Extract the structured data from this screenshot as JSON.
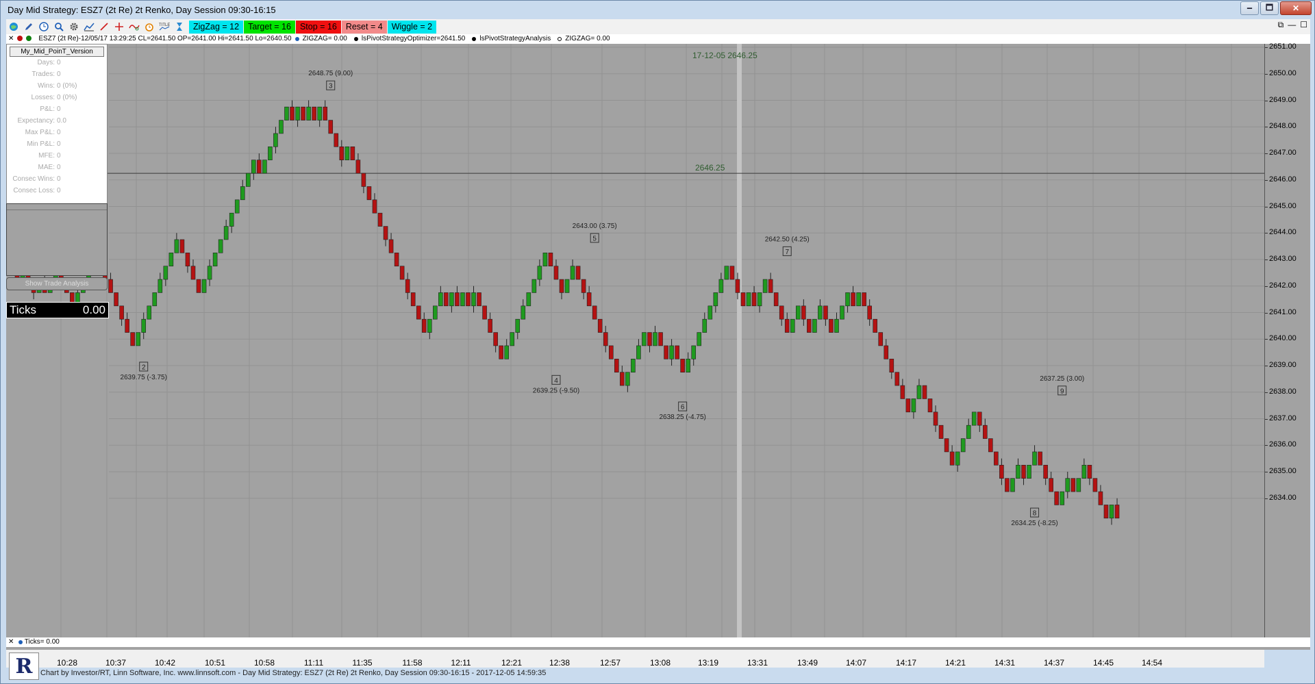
{
  "window": {
    "title": "Day Mid Strategy: ESZ7 (2t Re) 2t Renko, Day Session 09:30-16:15",
    "ctrl_restore": "🗗",
    "ctrl_min": "🗕",
    "ctrl_max": "🗖",
    "ctrl_close": "✕"
  },
  "toolbar": {
    "tools": [
      "globe-icon",
      "pencil-icon",
      "clock-icon",
      "magnifier-icon",
      "gear-icon",
      "chart-icon",
      "line-icon",
      "crosshair-icon",
      "link-icon",
      "alarm-icon",
      "title-icon",
      "hourglass-icon"
    ],
    "params": [
      {
        "label": "ZigZag = 12",
        "color": "#00e5ee"
      },
      {
        "label": "Target = 16",
        "color": "#00e400"
      },
      {
        "label": "Stop = 16",
        "color": "#f01010"
      },
      {
        "label": "Reset = 4",
        "color": "#f28a8a"
      },
      {
        "label": "Wiggle = 2",
        "color": "#00e5ee"
      }
    ],
    "right_icons": [
      "⧉",
      "—",
      "☐"
    ]
  },
  "infobar": {
    "close": "✕",
    "main": "ESZ7 (2t Re)-12/05/17 13:29:25 CL=2641.50 OP=2641.00 Hi=2641.50 Lo=2640.50",
    "zigzag": "ZIGZAG= 0.00",
    "optimizer": "lsPivotStrategyOptimizer=2641.50",
    "analysis": "lsPivotStrategyAnalysis",
    "zigzag2": "ZIGZAG= 0.00"
  },
  "stats": {
    "title": "My_Mid_PoinT_Version",
    "rows": [
      {
        "label": "Days:",
        "value": "0"
      },
      {
        "label": "Trades:",
        "value": "0"
      },
      {
        "label": "Wins:",
        "value": "0 (0%)"
      },
      {
        "label": "Losses:",
        "value": "0 (0%)"
      },
      {
        "label": "P&L:",
        "value": "0"
      },
      {
        "label": "Expectancy:",
        "value": "0.0"
      },
      {
        "label": "Max P&L:",
        "value": "0"
      },
      {
        "label": "Min P&L:",
        "value": "0"
      },
      {
        "label": "MFE:",
        "value": "0"
      },
      {
        "label": "MAE:",
        "value": "0"
      },
      {
        "label": "Consec Wins:",
        "value": "0"
      },
      {
        "label": "Consec Loss:",
        "value": "0"
      }
    ],
    "analysis_button": "Show Trade Analysis"
  },
  "ticks_box": {
    "label": "Ticks",
    "value": "0.00"
  },
  "ticks_bar": {
    "close": "✕",
    "label": "Ticks= 0.00"
  },
  "footer": "Chart by Investor/RT, Linn Software, Inc. www.linnsoft.com - Day Mid Strategy: ESZ7 (2t Re) 2t Renko, Day Session 09:30-16:15 - 2017-12-05 14:59:35",
  "logo": "R",
  "chart_data": {
    "type": "renko",
    "brick_size": 0.5,
    "ylim": [
      2633.25,
      2651.25
    ],
    "price_ticks": [
      "2651.00",
      "2650.00",
      "2649.00",
      "2648.00",
      "2647.00",
      "2646.00",
      "2645.00",
      "2644.00",
      "2643.00",
      "2642.00",
      "2641.00",
      "2640.00",
      "2639.00",
      "2638.00",
      "2637.00",
      "2636.00",
      "2635.00",
      "2634.00"
    ],
    "time_ticks": [
      "10:28",
      "10:37",
      "10:42",
      "10:51",
      "10:58",
      "11:11",
      "11:35",
      "11:58",
      "12:11",
      "12:21",
      "12:38",
      "12:57",
      "13:08",
      "13:19",
      "13:31",
      "13:49",
      "14:07",
      "14:17",
      "14:21",
      "14:31",
      "14:37",
      "14:45",
      "14:54"
    ],
    "horizontal_line": {
      "price": 2646.25,
      "label": "2646.25"
    },
    "cursor_label": {
      "date": "17-12-05",
      "price": "2646.25"
    },
    "pivots": [
      {
        "n": "2",
        "label": "2639.75 (-3.75)",
        "price": 2639.75,
        "type": "low",
        "bar": 24
      },
      {
        "n": "3",
        "label": "2648.75 (9.00)",
        "price": 2648.75,
        "type": "high",
        "bar": 58
      },
      {
        "n": "4",
        "label": "2639.25 (-9.50)",
        "price": 2639.25,
        "type": "low",
        "bar": 99
      },
      {
        "n": "5",
        "label": "2643.00 (3.75)",
        "price": 2643.0,
        "type": "high",
        "bar": 106
      },
      {
        "n": "6",
        "label": "2638.25 (-4.75)",
        "price": 2638.25,
        "type": "low",
        "bar": 122
      },
      {
        "n": "7",
        "label": "2642.50 (4.25)",
        "price": 2642.5,
        "type": "high",
        "bar": 141
      },
      {
        "n": "8",
        "label": "2634.25 (-8.25)",
        "price": 2634.25,
        "type": "low",
        "bar": 186
      },
      {
        "n": "9",
        "label": "2637.25 (3.00)",
        "price": 2637.25,
        "type": "high",
        "bar": 191
      }
    ],
    "path": [
      2642.75,
      2642.25,
      2642.75,
      2642.25,
      2641.75,
      2642.25,
      2641.75,
      2642.25,
      2642.75,
      2642.25,
      2641.75,
      2641.25,
      2641.75,
      2642.25,
      2642.75,
      2643.25,
      2642.75,
      2642.25,
      2641.75,
      2641.25,
      2640.75,
      2640.25,
      2639.75,
      2640.25,
      2640.75,
      2641.25,
      2641.75,
      2642.25,
      2642.75,
      2643.25,
      2643.75,
      2643.25,
      2642.75,
      2642.25,
      2641.75,
      2642.25,
      2642.75,
      2643.25,
      2643.75,
      2644.25,
      2644.75,
      2645.25,
      2645.75,
      2646.25,
      2646.75,
      2646.25,
      2646.75,
      2647.25,
      2647.75,
      2648.25,
      2648.75,
      2648.25,
      2648.75,
      2648.25,
      2648.75,
      2648.25,
      2648.75,
      2648.25,
      2647.75,
      2647.25,
      2646.75,
      2647.25,
      2646.75,
      2646.25,
      2645.75,
      2645.25,
      2644.75,
      2644.25,
      2643.75,
      2643.25,
      2642.75,
      2642.25,
      2641.75,
      2641.25,
      2640.75,
      2640.25,
      2640.75,
      2641.25,
      2641.75,
      2641.25,
      2641.75,
      2641.25,
      2641.75,
      2641.25,
      2641.75,
      2641.25,
      2640.75,
      2640.25,
      2639.75,
      2639.25,
      2639.75,
      2640.25,
      2640.75,
      2641.25,
      2641.75,
      2642.25,
      2642.75,
      2643.25,
      2642.75,
      2642.25,
      2641.75,
      2642.25,
      2642.75,
      2642.25,
      2641.75,
      2641.25,
      2640.75,
      2640.25,
      2639.75,
      2639.25,
      2638.75,
      2638.25,
      2638.75,
      2639.25,
      2639.75,
      2640.25,
      2639.75,
      2640.25,
      2639.75,
      2639.25,
      2639.75,
      2639.25,
      2638.75,
      2639.25,
      2639.75,
      2640.25,
      2640.75,
      2641.25,
      2641.75,
      2642.25,
      2642.75,
      2642.25,
      2641.75,
      2641.25,
      2641.75,
      2641.25,
      2641.75,
      2642.25,
      2641.75,
      2641.25,
      2640.75,
      2640.25,
      2640.75,
      2641.25,
      2640.75,
      2640.25,
      2640.75,
      2641.25,
      2640.75,
      2640.25,
      2640.75,
      2641.25,
      2641.75,
      2641.25,
      2641.75,
      2641.25,
      2640.75,
      2640.25,
      2639.75,
      2639.25,
      2638.75,
      2638.25,
      2637.75,
      2637.25,
      2637.75,
      2638.25,
      2637.75,
      2637.25,
      2636.75,
      2636.25,
      2635.75,
      2635.25,
      2635.75,
      2636.25,
      2636.75,
      2637.25,
      2636.75,
      2636.25,
      2635.75,
      2635.25,
      2634.75,
      2634.25,
      2634.75,
      2635.25,
      2634.75,
      2635.25,
      2635.75,
      2635.25,
      2634.75,
      2634.25,
      2633.75,
      2634.25,
      2634.75,
      2634.25,
      2634.75,
      2635.25,
      2634.75,
      2634.25,
      2633.75,
      2633.25,
      2633.75,
      2633.25
    ]
  }
}
